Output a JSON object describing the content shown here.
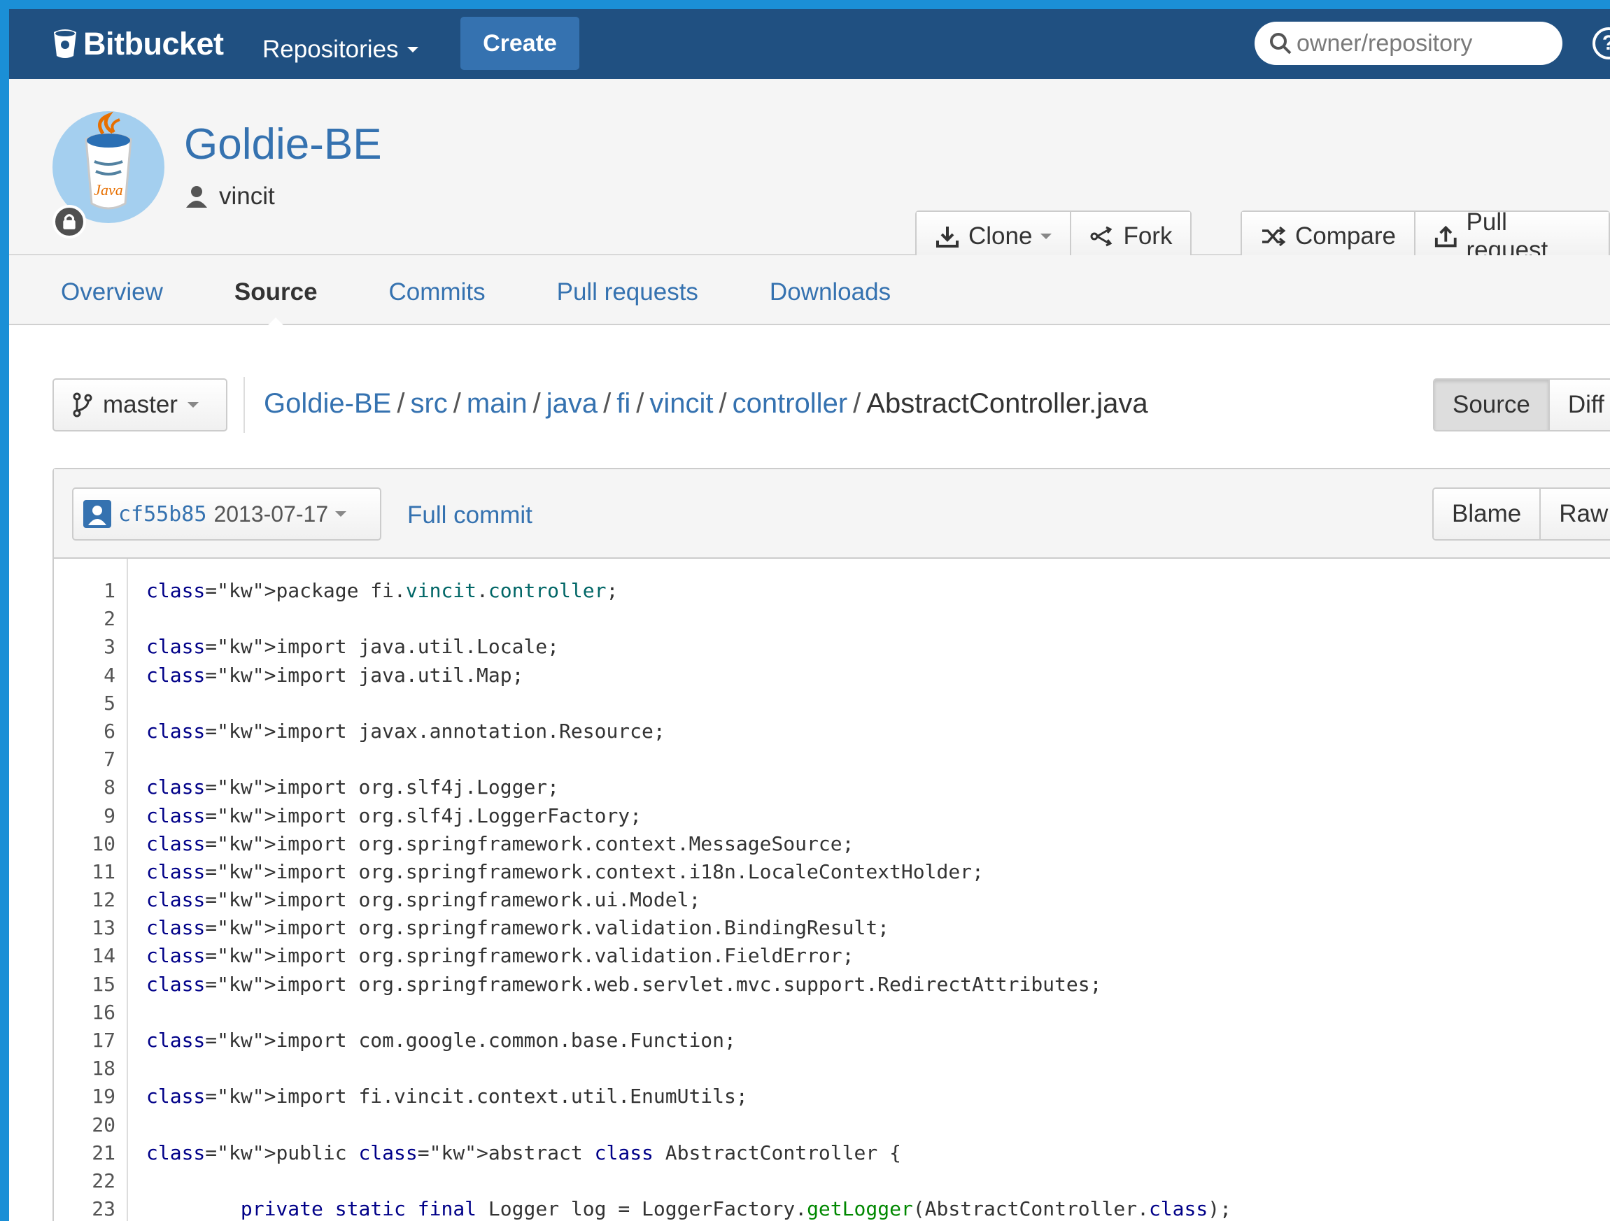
{
  "app": {
    "brand": "Bitbucket",
    "nav_repositories": "Repositories",
    "create_label": "Create",
    "search_placeholder": "owner/repository",
    "help_label": "?"
  },
  "repo": {
    "name": "Goldie-BE",
    "owner": "vincit",
    "avatar_label": "Java",
    "actions": {
      "clone": "Clone",
      "fork": "Fork",
      "compare": "Compare",
      "pull_request": "Pull request"
    }
  },
  "tabs": [
    {
      "label": "Overview",
      "active": false
    },
    {
      "label": "Source",
      "active": true
    },
    {
      "label": "Commits",
      "active": false
    },
    {
      "label": "Pull requests",
      "active": false
    },
    {
      "label": "Downloads",
      "active": false
    }
  ],
  "branch": "master",
  "breadcrumb": {
    "segments": [
      "Goldie-BE",
      "src",
      "main",
      "java",
      "fi",
      "vincit",
      "controller"
    ],
    "file": "AbstractController.java"
  },
  "view_toggle": {
    "source": "Source",
    "diff": "Diff"
  },
  "file_toolbar": {
    "commit_hash": "cf55b85",
    "commit_date": "2013-07-17",
    "full_commit": "Full commit",
    "blame": "Blame",
    "raw": "Raw"
  },
  "code_lines": [
    "package fi.vincit.controller;",
    "",
    "import java.util.Locale;",
    "import java.util.Map;",
    "",
    "import javax.annotation.Resource;",
    "",
    "import org.slf4j.Logger;",
    "import org.slf4j.LoggerFactory;",
    "import org.springframework.context.MessageSource;",
    "import org.springframework.context.i18n.LocaleContextHolder;",
    "import org.springframework.ui.Model;",
    "import org.springframework.validation.BindingResult;",
    "import org.springframework.validation.FieldError;",
    "import org.springframework.web.servlet.mvc.support.RedirectAttributes;",
    "",
    "import com.google.common.base.Function;",
    "",
    "import fi.vincit.context.util.EnumUtils;",
    "",
    "public abstract class AbstractController {",
    "",
    "        private static final Logger log = LoggerFactory.getLogger(AbstractController.class);"
  ],
  "colors": {
    "nav_bg": "#205081",
    "accent": "#3572b0",
    "outer_bg": "#1b8fd6"
  }
}
